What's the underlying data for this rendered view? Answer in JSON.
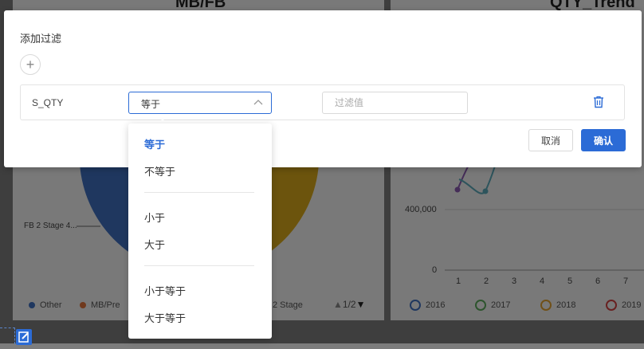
{
  "background": {
    "left_chart": {
      "title": "MB/FB",
      "pie_label": "FB 2 Stage 4...",
      "legend": [
        {
          "label": "Other",
          "color": "#3f6fbf"
        },
        {
          "label": "MB/Pre",
          "color": "#e0733a"
        },
        {
          "label": "2 Stage",
          "color": "#d8a81a"
        }
      ],
      "pager": "1/2"
    },
    "right_chart": {
      "title": "QTY_Trend",
      "y_ticks": [
        "400,000",
        "0"
      ],
      "x_ticks": [
        "1",
        "2",
        "3",
        "4",
        "5",
        "6",
        "7"
      ],
      "legend": [
        {
          "label": "2016",
          "color": "#3f6fbf"
        },
        {
          "label": "2017",
          "color": "#5aa85a"
        },
        {
          "label": "2018",
          "color": "#e0a030"
        },
        {
          "label": "2019",
          "color": "#d04040"
        }
      ]
    }
  },
  "dialog": {
    "title": "添加过滤",
    "add_icon": "plus-icon",
    "filter": {
      "field": "S_QTY",
      "operator": "等于",
      "value_placeholder": "过滤值",
      "value": ""
    },
    "cancel_label": "取消",
    "confirm_label": "确认",
    "accent": "#2b6bd6"
  },
  "dropdown": {
    "groups": [
      [
        {
          "label": "等于",
          "selected": true
        },
        {
          "label": "不等于",
          "selected": false
        }
      ],
      [
        {
          "label": "小于",
          "selected": false
        },
        {
          "label": "大于",
          "selected": false
        }
      ],
      [
        {
          "label": "小于等于",
          "selected": false
        },
        {
          "label": "大于等于",
          "selected": false
        }
      ]
    ]
  }
}
